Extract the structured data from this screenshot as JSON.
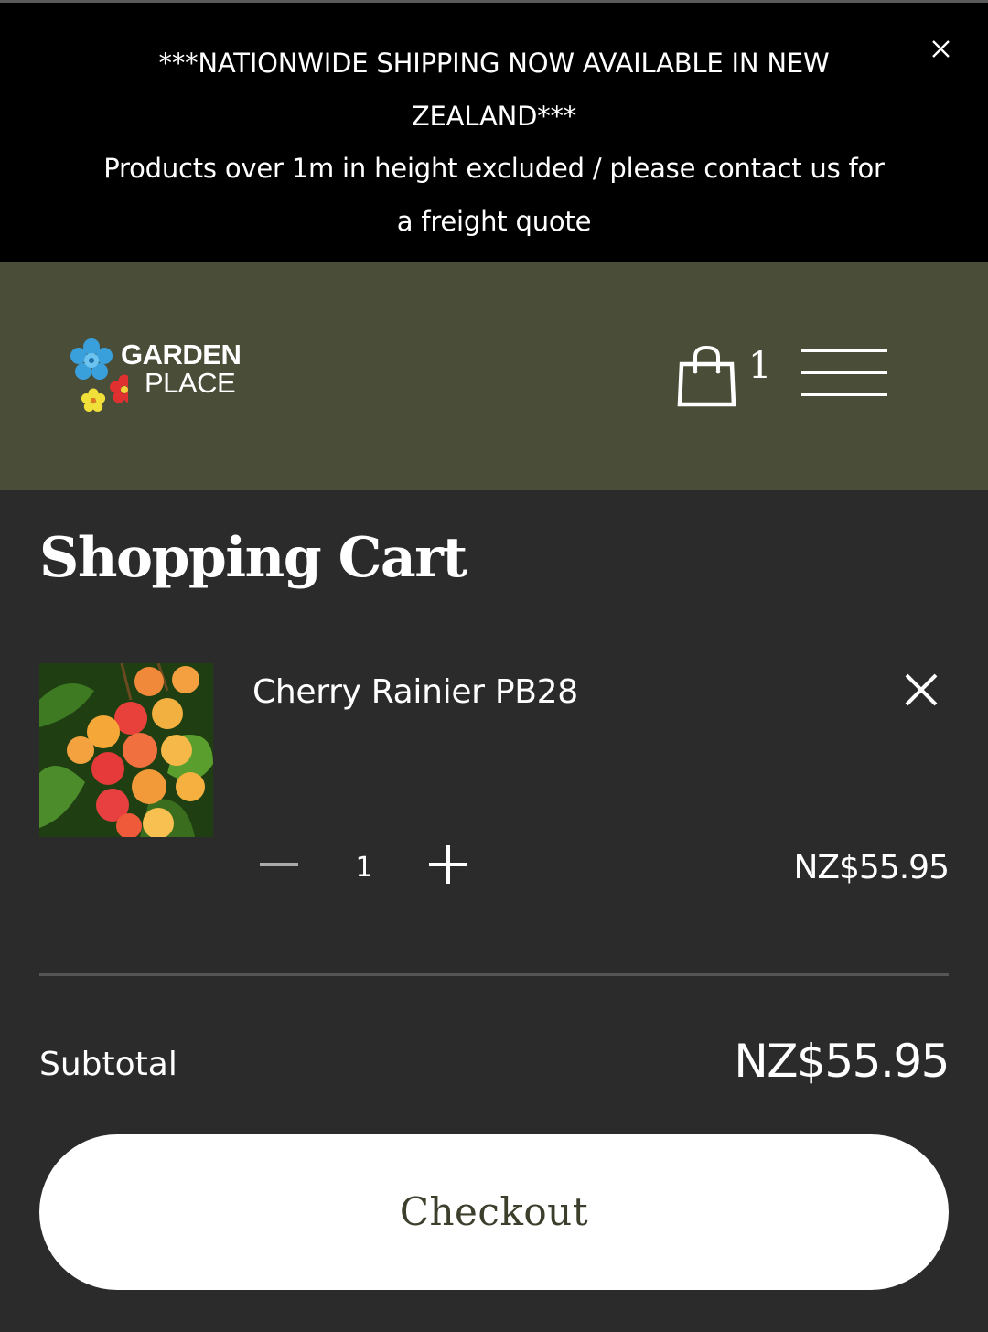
{
  "announcement": {
    "line1": "***NATIONWIDE SHIPPING NOW AVAILABLE IN NEW ZEALAND***",
    "line2": "Products over 1m in height excluded / please contact us for a freight quote"
  },
  "header": {
    "logo": {
      "line1": "GARDEN",
      "line2": "PLACE"
    },
    "cart_count": "1"
  },
  "cart": {
    "title": "Shopping Cart",
    "items": [
      {
        "name": "Cherry Rainier PB28",
        "quantity": "1",
        "price": "NZ$55.95"
      }
    ],
    "subtotal_label": "Subtotal",
    "subtotal_value": "NZ$55.95",
    "checkout_label": "Checkout"
  },
  "colors": {
    "announcement_bg": "#000000",
    "header_bg": "#4a4d37",
    "page_bg": "#2b2b2b",
    "checkout_text": "#3b3f2c"
  }
}
